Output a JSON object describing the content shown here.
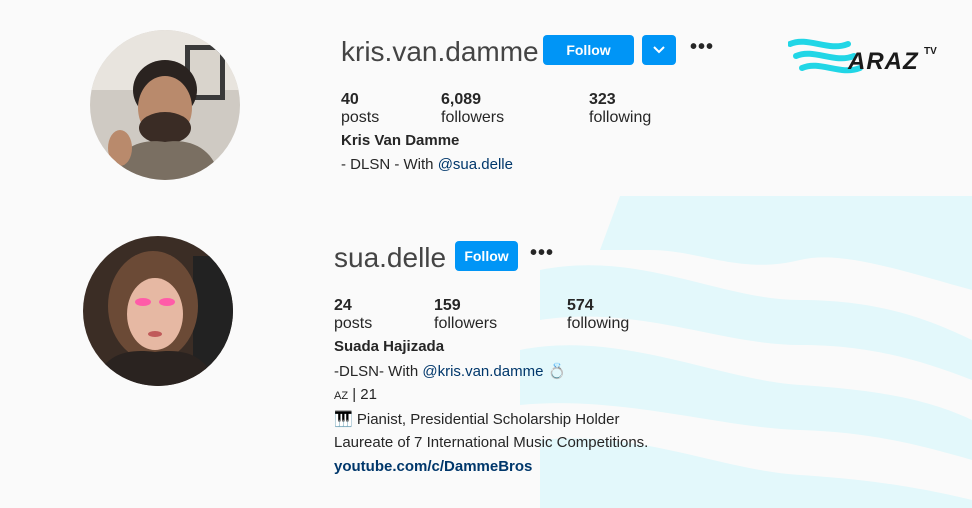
{
  "logo": {
    "text": "ARAZ",
    "suffix": "TV"
  },
  "profiles": [
    {
      "username": "kris.van.damme",
      "follow_label": "Follow",
      "posts_count": "40",
      "posts_label": "posts",
      "followers_count": "6,089",
      "followers_label": "followers",
      "following_count": "323",
      "following_label": "following",
      "full_name": "Kris Van Damme",
      "bio_prefix": "- DLSN - With ",
      "bio_mention": "@sua.delle"
    },
    {
      "username": "sua.delle",
      "follow_label": "Follow",
      "posts_count": "24",
      "posts_label": "posts",
      "followers_count": "159",
      "followers_label": "followers",
      "following_count": "574",
      "following_label": "following",
      "full_name": "Suada Hajizada",
      "bio_prefix": "-DLSN- With ",
      "bio_mention": "@kris.van.damme",
      "bio_ring": "💍",
      "bio_country": "AZ",
      "bio_age": " | 21",
      "bio_piano": "🎹",
      "bio_line3": " Pianist, Presidential Scholarship Holder",
      "bio_line4": "Laureate of 7 International Music Competitions.",
      "link": "youtube.com/c/DammeBros"
    }
  ]
}
